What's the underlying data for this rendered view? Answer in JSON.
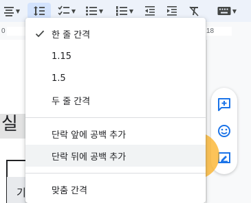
{
  "toolbar": {
    "icons": [
      "align-icon",
      "line-spacing-icon",
      "checklist-icon",
      "bulleted-list-icon",
      "numbered-list-icon",
      "decrease-indent-icon",
      "increase-indent-icon",
      "clear-formatting-icon",
      "keyboard-icon"
    ]
  },
  "ruler": {
    "left_number": "0",
    "right_number": "18"
  },
  "document": {
    "heading_fragment": "실",
    "cell_fragment": "기"
  },
  "line_spacing_menu": {
    "items": [
      {
        "label": "한 줄 간격",
        "checked": true
      },
      {
        "label": "1.15",
        "checked": false
      },
      {
        "label": "1.5",
        "checked": false
      },
      {
        "label": "두 줄 간격",
        "checked": false
      }
    ],
    "paragraph_items": [
      {
        "label": "단락 앞에 공백 추가"
      },
      {
        "label": "단락 뒤에 공백 추가",
        "hovered": true
      }
    ],
    "custom_item": {
      "label": "맞춤 간격"
    }
  },
  "side_panel": {
    "icons": [
      "add-comment-icon",
      "emoji-reaction-icon",
      "suggest-edits-icon"
    ]
  },
  "colors": {
    "accent": "#1a73e8",
    "toolbar_bg": "#edf2fa",
    "active_bg": "#d3e3fd",
    "click_indicator": "#fbb229"
  }
}
